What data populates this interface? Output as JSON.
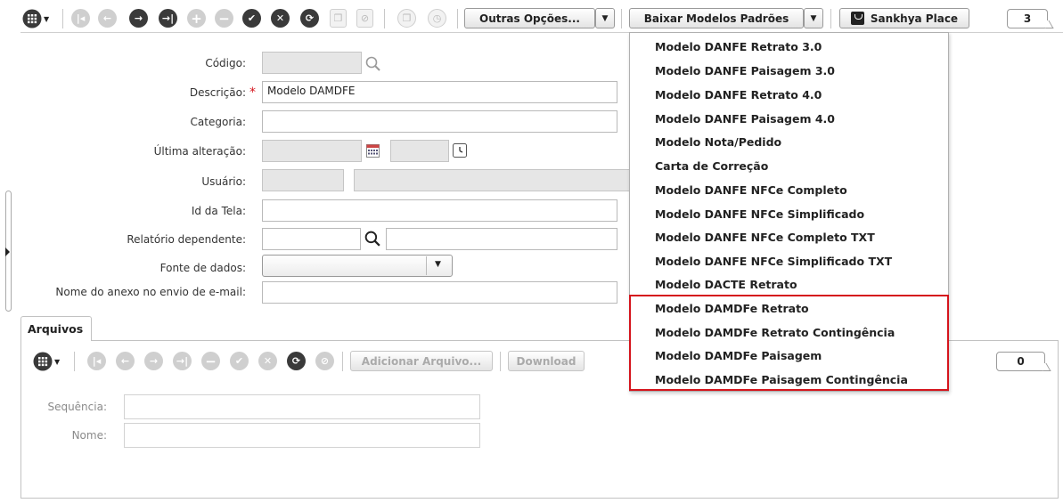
{
  "toolbar": {
    "outras_opcoes": "Outras Opções...",
    "baixar_modelos": "Baixar Modelos Padrões",
    "sankhya_place": "Sankhya Place",
    "record_count": "3"
  },
  "form": {
    "codigo_label": "Código:",
    "codigo_value": "",
    "descricao_label": "Descrição:",
    "descricao_required": "*",
    "descricao_value": "Modelo DAMDFE",
    "categoria_label": "Categoria:",
    "ultima_alteracao_label": "Última alteração:",
    "usuario_label": "Usuário:",
    "id_tela_label": "Id da Tela:",
    "relatorio_label": "Relatório dependente:",
    "fonte_label": "Fonte de dados:",
    "anexo_label": "Nome do anexo no envio de e-mail:"
  },
  "dropdown": {
    "items": [
      "Modelo DANFE Retrato 3.0",
      "Modelo DANFE Paisagem 3.0",
      "Modelo DANFE Retrato 4.0",
      "Modelo DANFE Paisagem 4.0",
      "Modelo Nota/Pedido",
      "Carta de Correção",
      "Modelo DANFE NFCe Completo",
      "Modelo DANFE NFCe Simplificado",
      "Modelo DANFE NFCe Completo TXT",
      "Modelo DANFE NFCe Simplificado TXT",
      "Modelo DACTE Retrato",
      "Modelo DAMDFe Retrato",
      "Modelo DAMDFe Retrato Contingência",
      "Modelo DAMDFe Paisagem",
      "Modelo DAMDFe Paisagem Contingência"
    ],
    "highlight_color": "#d5141c"
  },
  "arquivos": {
    "tab_label": "Arquivos",
    "adicionar": "Adicionar Arquivo...",
    "download": "Download",
    "count": "0",
    "sequencia_label": "Sequência:",
    "nome_label": "Nome:"
  }
}
